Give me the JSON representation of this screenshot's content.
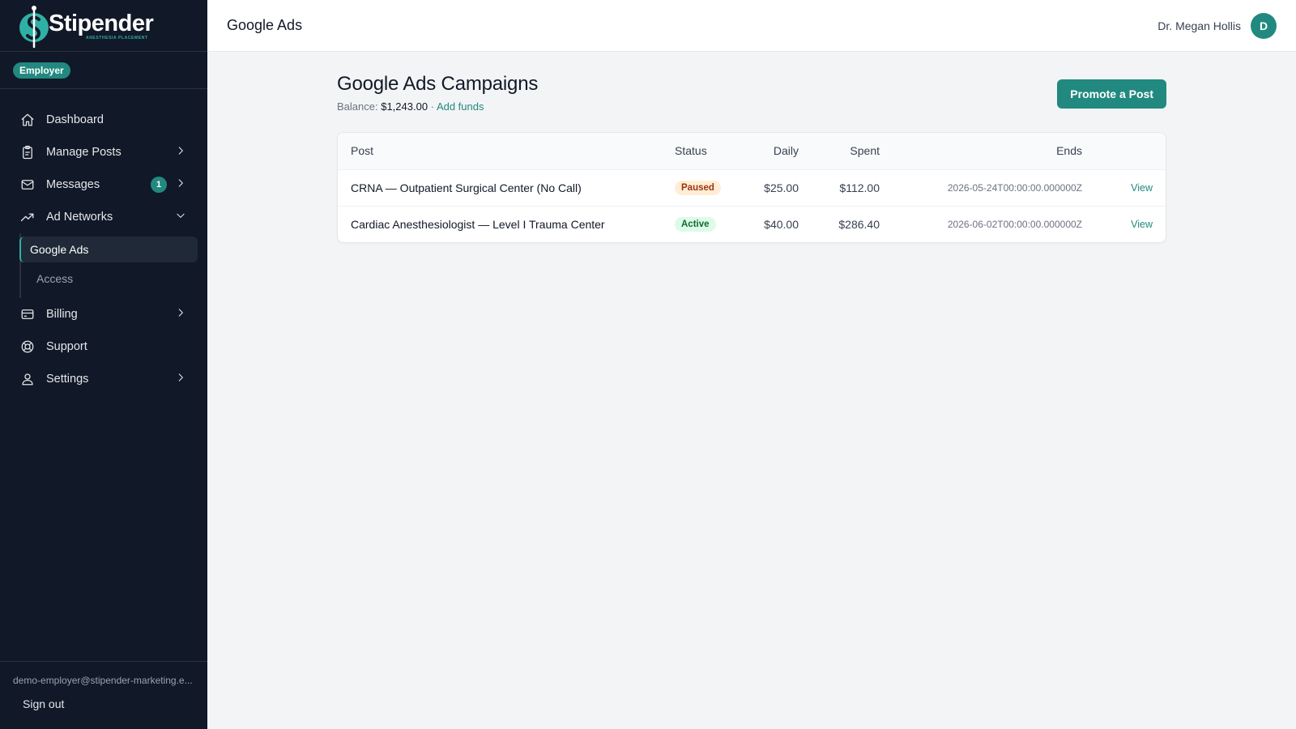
{
  "brand": {
    "name": "Stipender",
    "tagline": "ANESTHESIA PLACEMENT",
    "accent": "#21897f"
  },
  "sidebar": {
    "role_badge": "Employer",
    "items": [
      {
        "label": "Dashboard",
        "icon": "home-icon"
      },
      {
        "label": "Manage Posts",
        "icon": "clipboard-icon"
      },
      {
        "label": "Messages",
        "icon": "mail-icon",
        "badge": "1"
      },
      {
        "label": "Ad Networks",
        "icon": "trending-up-icon",
        "expanded": true
      },
      {
        "label": "Billing",
        "icon": "credit-card-icon"
      },
      {
        "label": "Support",
        "icon": "lifebuoy-icon"
      },
      {
        "label": "Settings",
        "icon": "user-icon"
      }
    ],
    "subitems": [
      {
        "label": "Google Ads",
        "active": true
      },
      {
        "label": "Access",
        "active": false
      }
    ],
    "email": "demo-employer@stipender-marketing.e...",
    "signout": "Sign out"
  },
  "header": {
    "title": "Google Ads",
    "user_name": "Dr. Megan Hollis",
    "avatar_initial": "D"
  },
  "main": {
    "title": "Google Ads Campaigns",
    "balance_label": "Balance:",
    "balance_value": "$1,243.00",
    "separator": "·",
    "add_funds": "Add funds",
    "promote_button": "Promote a Post",
    "columns": [
      "Post",
      "Status",
      "Daily",
      "Spent",
      "Ends"
    ],
    "rows": [
      {
        "post": "CRNA — Outpatient Surgical Center (No Call)",
        "status": "Paused",
        "daily": "$25.00",
        "spent": "$112.00",
        "ends": "2026-05-24T00:00:00.000000Z",
        "action": "View"
      },
      {
        "post": "Cardiac Anesthesiologist — Level I Trauma Center",
        "status": "Active",
        "daily": "$40.00",
        "spent": "$286.40",
        "ends": "2026-06-02T00:00:00.000000Z",
        "action": "View"
      }
    ]
  }
}
